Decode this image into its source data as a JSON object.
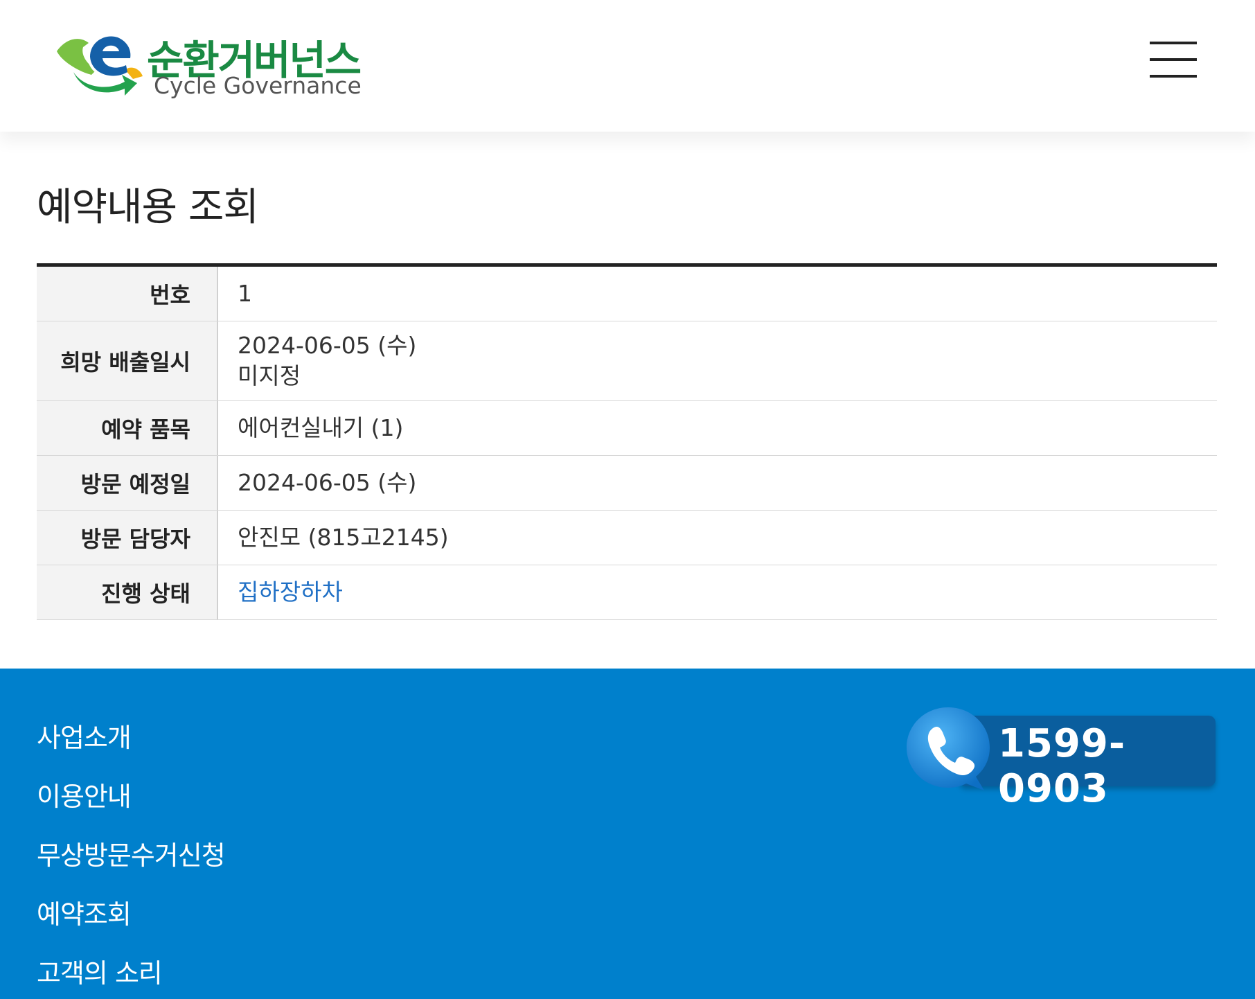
{
  "header": {
    "logo": {
      "title_ko": "순환거버넌스",
      "subtitle_en": "Cycle Governance",
      "mark_icon": "e-recycle-logo-icon"
    },
    "menu_icon": "hamburger-menu-icon"
  },
  "page_title": "예약내용 조회",
  "reservation": {
    "rows": [
      {
        "label": "번호",
        "value": "1"
      },
      {
        "label": "희망 배출일시",
        "value": "2024-06-05 (수)",
        "value2": "미지정"
      },
      {
        "label": "예약 품목",
        "value": "에어컨실내기 (1)"
      },
      {
        "label": "방문 예정일",
        "value": "2024-06-05 (수)"
      },
      {
        "label": "방문 담당자",
        "value": "안진모 (815고2145)"
      },
      {
        "label": "진행 상태",
        "value": "집하장하차"
      }
    ]
  },
  "footer": {
    "nav": [
      "사업소개",
      "이용안내",
      "무상방문수거신청",
      "예약조회",
      "고객의 소리"
    ],
    "phone": "1599-0903",
    "phone_icon": "phone-icon"
  },
  "colors": {
    "brand_green": "#1a8a43",
    "brand_blue": "#1560a8",
    "footer_bg": "#0080cc",
    "status_link": "#1f6fc5"
  }
}
